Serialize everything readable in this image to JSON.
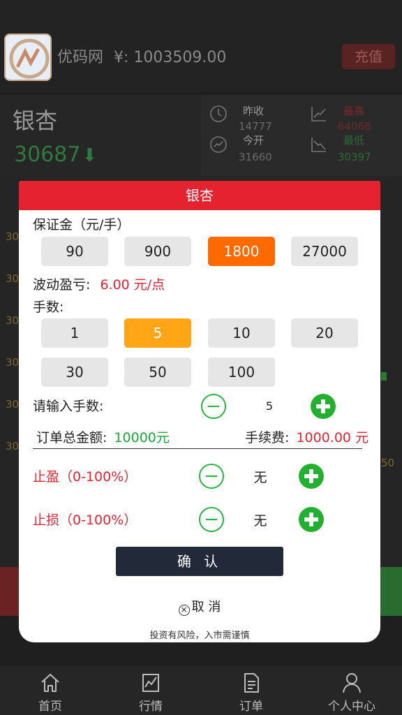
{
  "header": {
    "brand": "优码网",
    "balance_label": "¥:",
    "balance": "1003509.00",
    "recharge_label": "充值"
  },
  "quote": {
    "name": "银杏",
    "price": "30687",
    "prev_close_label": "昨收",
    "prev_close": "14777",
    "open_label": "今开",
    "open": "31660",
    "high_label": "最高",
    "high": "64068",
    "low_label": "最低",
    "low": "30397"
  },
  "background_axis": [
    "30",
    "30",
    "30",
    "30",
    "30",
    "30"
  ],
  "background_axis_right": "50",
  "modal": {
    "title": "银杏",
    "margin_label": "保证金（元/手）",
    "margin_options": [
      "90",
      "900",
      "1800",
      "27000"
    ],
    "margin_selected": "1800",
    "fluct_label": "波动盈亏:",
    "fluct_value": "6.00 元/点",
    "lots_label": "手数:",
    "lots_options": [
      "1",
      "5",
      "10",
      "20",
      "30",
      "50",
      "100"
    ],
    "lots_selected": "5",
    "input_lots_label": "请输入手数:",
    "input_lots_value": "5",
    "total_label": "订单总金额:",
    "total_value": "10000元",
    "fee_label": "手续费:",
    "fee_value": "1000.00 元",
    "take_profit_label": "止盈（0-100%）",
    "take_profit_value": "无",
    "stop_loss_label": "止损（0-100%）",
    "stop_loss_value": "无",
    "confirm_label": "确 认",
    "cancel_label": "取 消",
    "risk_text": "投资有风险，入市需谨慎"
  },
  "nav": [
    {
      "label": "首页",
      "icon": "home-icon"
    },
    {
      "label": "行情",
      "icon": "chart-icon"
    },
    {
      "label": "订单",
      "icon": "document-icon"
    },
    {
      "label": "个人中心",
      "icon": "user-icon"
    }
  ]
}
